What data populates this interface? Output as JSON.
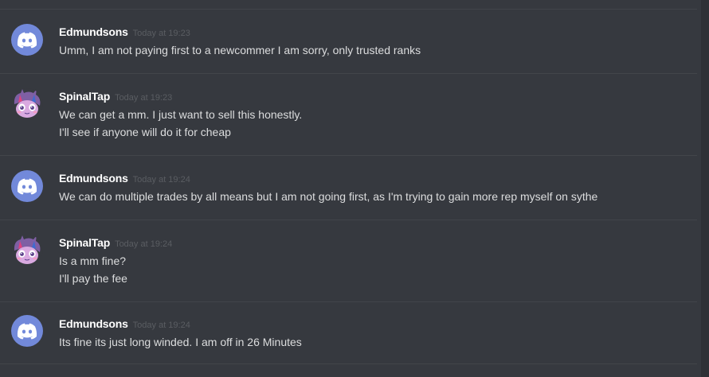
{
  "messages": [
    {
      "author": "Edmundsons",
      "timestamp": "Today at 19:23",
      "avatar": "discord-logo",
      "lines": [
        "Umm, I am not paying first to a newcommer I am sorry, only trusted ranks"
      ]
    },
    {
      "author": "SpinalTap",
      "timestamp": "Today at 19:23",
      "avatar": "pony-avatar",
      "lines": [
        "We can get a mm. I just want to sell this honestly.",
        "I'll see if anyone will do it for cheap"
      ]
    },
    {
      "author": "Edmundsons",
      "timestamp": "Today at 19:24",
      "avatar": "discord-logo",
      "lines": [
        "We can do multiple trades by all means but I am not going first, as I'm trying to gain more rep myself on sythe"
      ]
    },
    {
      "author": "SpinalTap",
      "timestamp": "Today at 19:24",
      "avatar": "pony-avatar",
      "lines": [
        "Is a mm fine?",
        "I'll pay the fee"
      ]
    },
    {
      "author": "Edmundsons",
      "timestamp": "Today at 19:24",
      "avatar": "discord-logo",
      "lines": [
        "Its fine its just long winded. I am off in 26 Minutes"
      ]
    }
  ],
  "colors": {
    "background": "#36393f",
    "divider": "#42454a",
    "username": "#ffffff",
    "timestamp": "#5a5d62",
    "message_text": "#dcddde",
    "discord_blurple": "#7289da"
  }
}
